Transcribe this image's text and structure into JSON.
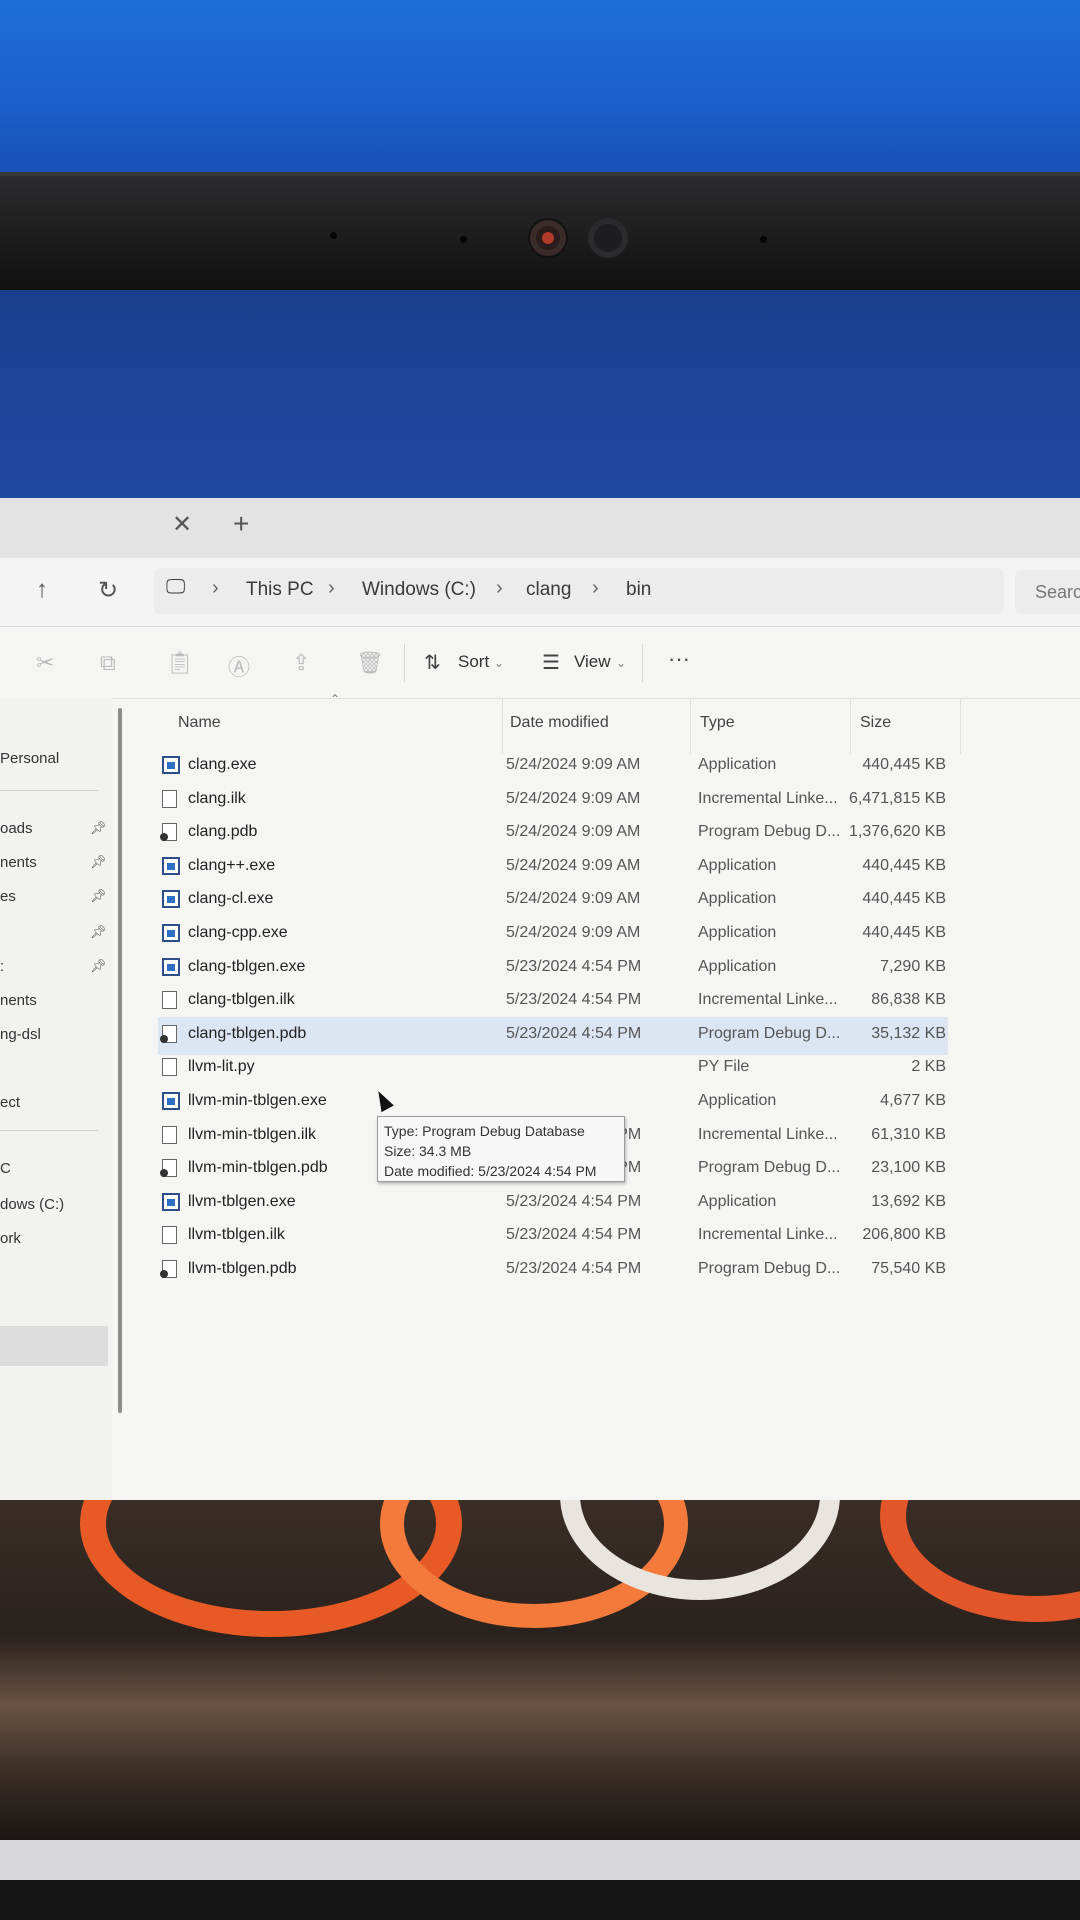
{
  "tabs": {
    "close_icon": "close-icon",
    "new_tab_icon": "plus-icon"
  },
  "breadcrumb": [
    "This PC",
    "Windows (C:)",
    "clang",
    "bin"
  ],
  "search": {
    "placeholder": "Searc"
  },
  "toolbar": {
    "sort_label": "Sort",
    "view_label": "View",
    "more_label": "···"
  },
  "sidebar": {
    "items": [
      {
        "label": "Personal"
      },
      {
        "label": "oads",
        "pinned": true
      },
      {
        "label": "nents",
        "pinned": true
      },
      {
        "label": "es",
        "pinned": true
      },
      {
        "label": "",
        "pinned": true
      },
      {
        "label": ":",
        "pinned": true
      },
      {
        "label": "nents"
      },
      {
        "label": "ng-dsl"
      },
      {
        "label": "ect"
      },
      {
        "label": "C"
      },
      {
        "label": "dows (C:)",
        "selected": true
      },
      {
        "label": "ork"
      }
    ]
  },
  "columns": {
    "name": "Name",
    "date": "Date modified",
    "type": "Type",
    "size": "Size"
  },
  "files": [
    {
      "name": "clang.exe",
      "date": "5/24/2024 9:09 AM",
      "type": "Application",
      "size": "440,445 KB",
      "icon": "app"
    },
    {
      "name": "clang.ilk",
      "date": "5/24/2024 9:09 AM",
      "type": "Incremental Linke...",
      "size": "6,471,815 KB",
      "icon": "doc"
    },
    {
      "name": "clang.pdb",
      "date": "5/24/2024 9:09 AM",
      "type": "Program Debug D...",
      "size": "1,376,620 KB",
      "icon": "pdb"
    },
    {
      "name": "clang++.exe",
      "date": "5/24/2024 9:09 AM",
      "type": "Application",
      "size": "440,445 KB",
      "icon": "app"
    },
    {
      "name": "clang-cl.exe",
      "date": "5/24/2024 9:09 AM",
      "type": "Application",
      "size": "440,445 KB",
      "icon": "app"
    },
    {
      "name": "clang-cpp.exe",
      "date": "5/24/2024 9:09 AM",
      "type": "Application",
      "size": "440,445 KB",
      "icon": "app"
    },
    {
      "name": "clang-tblgen.exe",
      "date": "5/23/2024 4:54 PM",
      "type": "Application",
      "size": "7,290 KB",
      "icon": "app"
    },
    {
      "name": "clang-tblgen.ilk",
      "date": "5/23/2024 4:54 PM",
      "type": "Incremental Linke...",
      "size": "86,838 KB",
      "icon": "doc"
    },
    {
      "name": "clang-tblgen.pdb",
      "date": "5/23/2024 4:54 PM",
      "type": "Program Debug D...",
      "size": "35,132 KB",
      "icon": "pdb",
      "selected": true
    },
    {
      "name": "llvm-lit.py",
      "date": "",
      "type": "PY File",
      "size": "2 KB",
      "icon": "doc"
    },
    {
      "name": "llvm-min-tblgen.exe",
      "date": "",
      "type": "Application",
      "size": "4,677 KB",
      "icon": "app"
    },
    {
      "name": "llvm-min-tblgen.ilk",
      "date": "5/23/2024 4:53 PM",
      "type": "Incremental Linke...",
      "size": "61,310 KB",
      "icon": "doc"
    },
    {
      "name": "llvm-min-tblgen.pdb",
      "date": "5/23/2024 4:53 PM",
      "type": "Program Debug D...",
      "size": "23,100 KB",
      "icon": "pdb"
    },
    {
      "name": "llvm-tblgen.exe",
      "date": "5/23/2024 4:54 PM",
      "type": "Application",
      "size": "13,692 KB",
      "icon": "app"
    },
    {
      "name": "llvm-tblgen.ilk",
      "date": "5/23/2024 4:54 PM",
      "type": "Incremental Linke...",
      "size": "206,800 KB",
      "icon": "doc"
    },
    {
      "name": "llvm-tblgen.pdb",
      "date": "5/23/2024 4:54 PM",
      "type": "Program Debug D...",
      "size": "75,540 KB",
      "icon": "pdb"
    }
  ],
  "tooltip": {
    "type_line": "Type: Program Debug Database",
    "size_line": "Size: 34.3 MB",
    "date_line": "Date modified: 5/23/2024 4:54 PM"
  }
}
